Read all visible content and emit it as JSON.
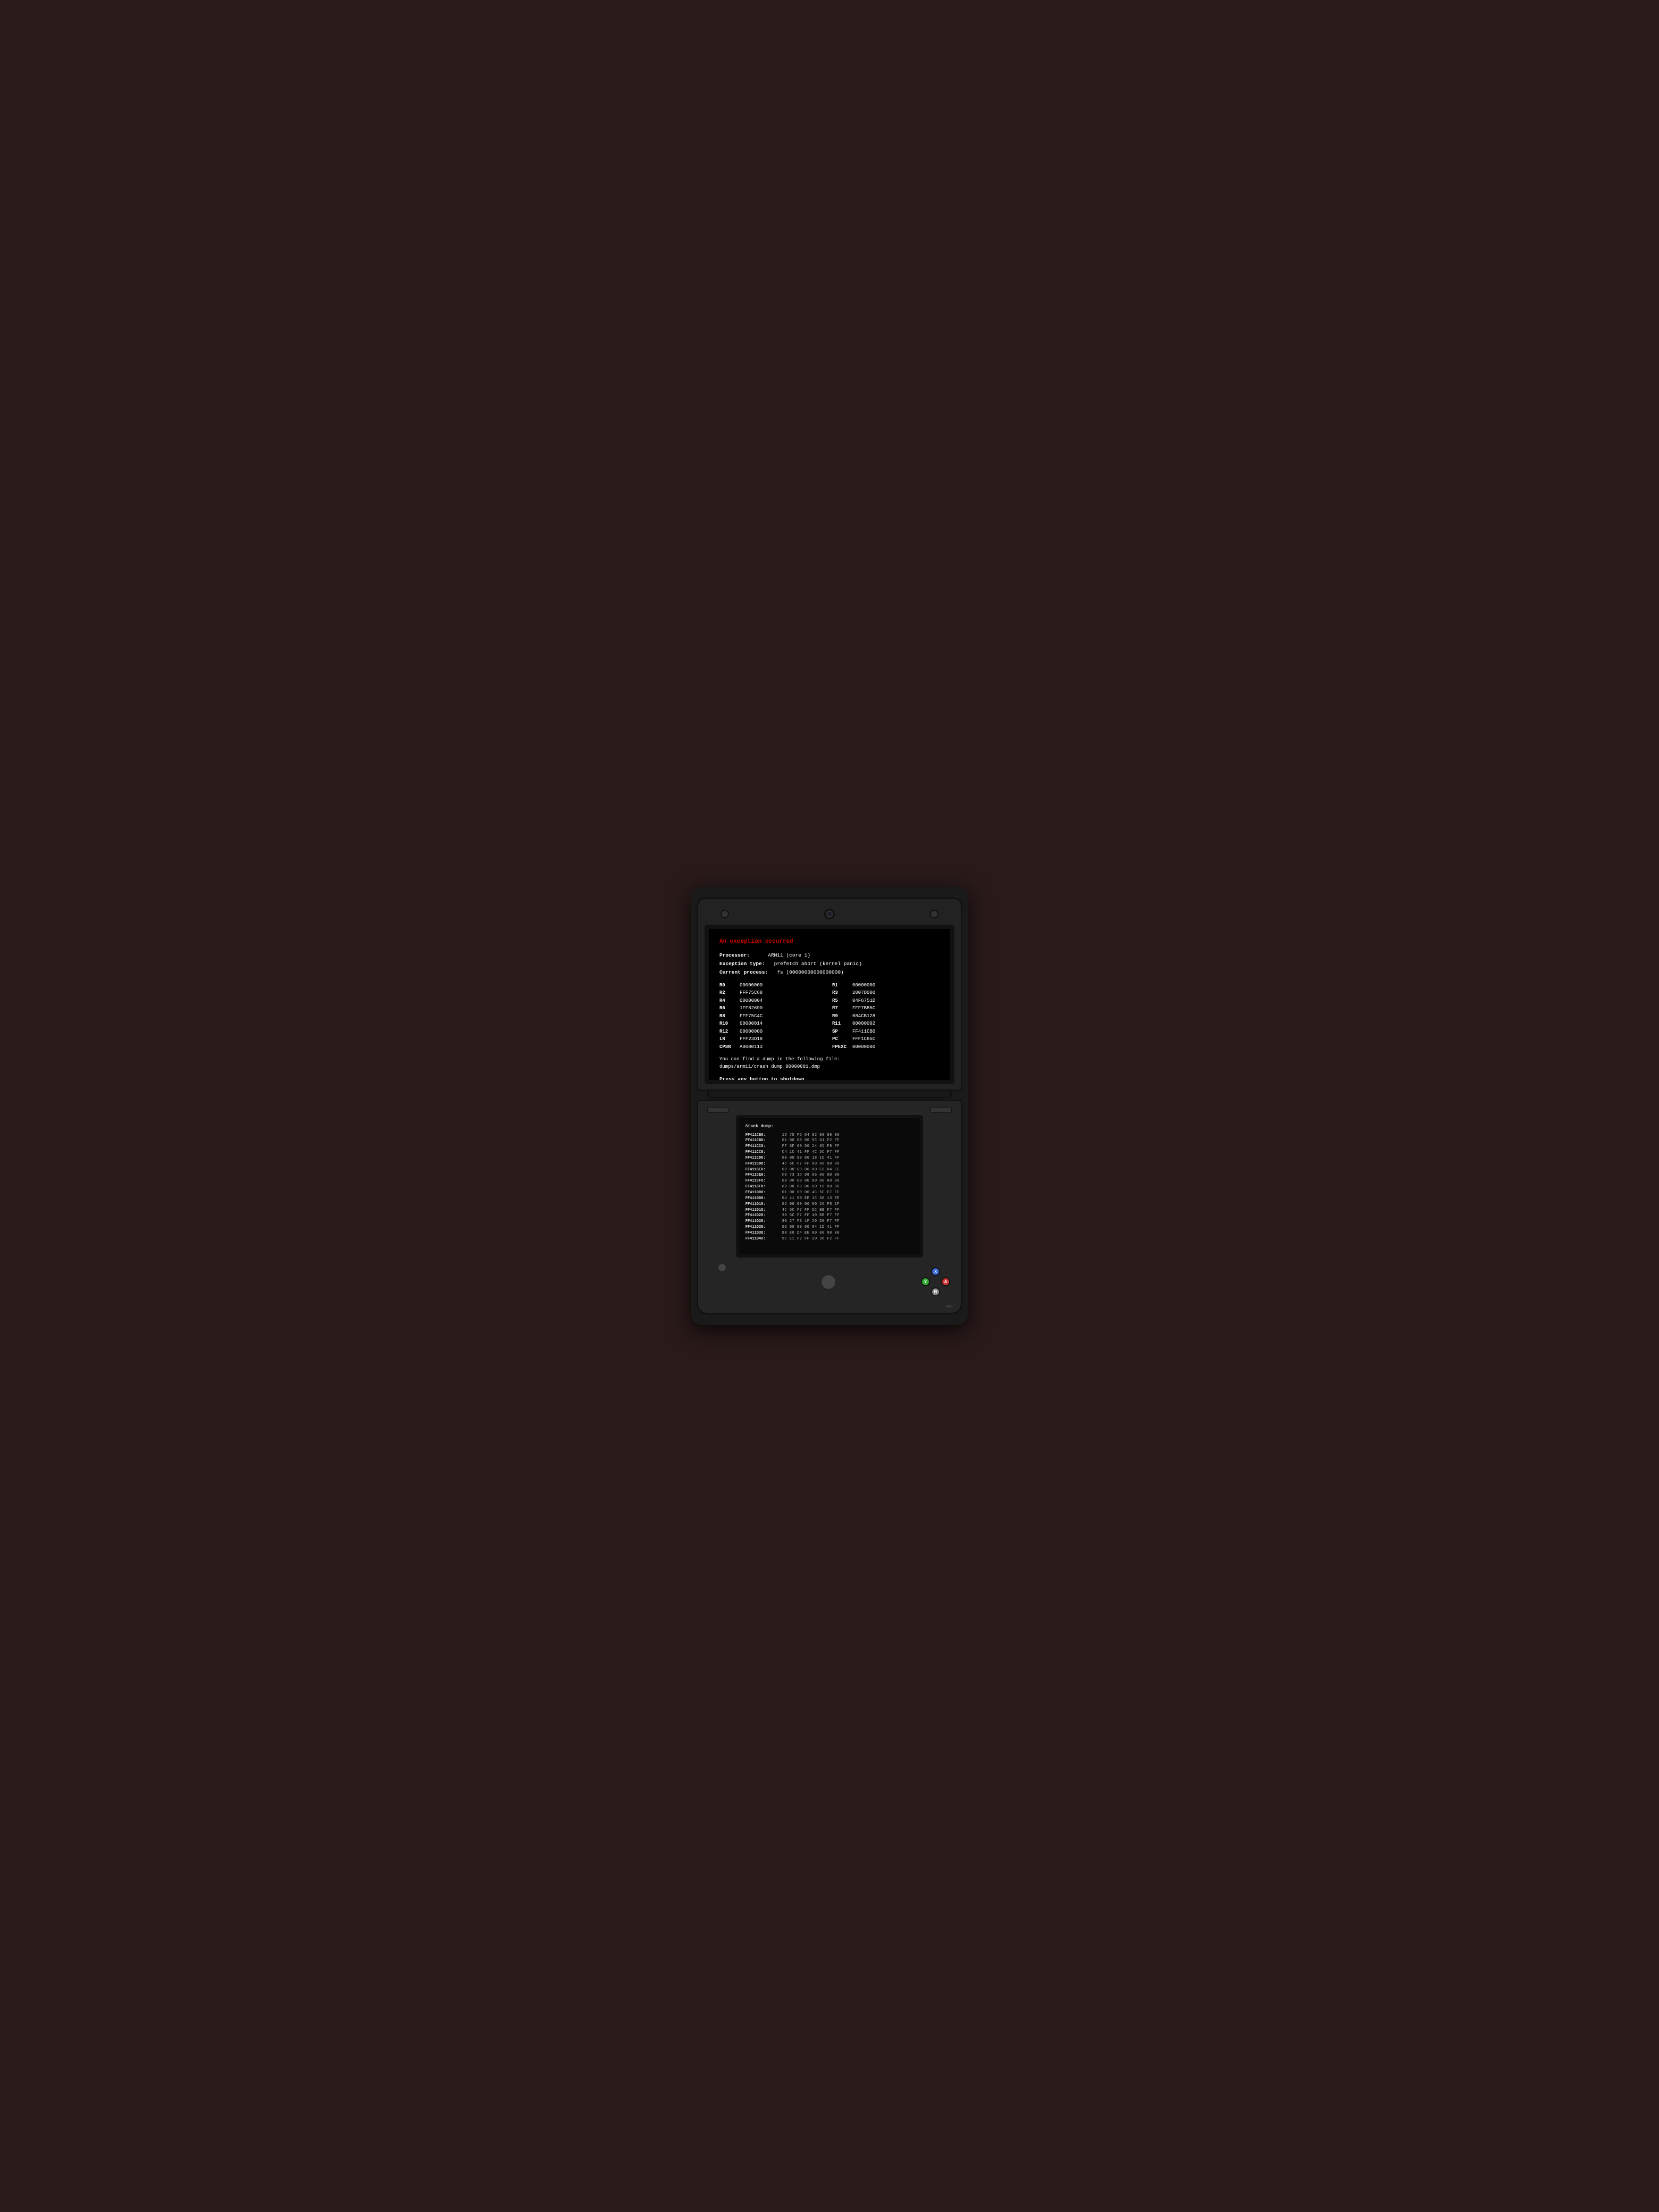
{
  "device": {
    "top_screen": {
      "error_title": "An exception occurred",
      "processor_label": "Processor:",
      "processor_value": "ARM11 (core 1)",
      "exception_type_label": "Exception type:",
      "exception_type_value": "prefetch abort (kernel panic)",
      "current_process_label": "Current process:",
      "current_process_value": "fs (00000000000000000)",
      "registers": [
        {
          "name": "R0",
          "value": "00000000"
        },
        {
          "name": "R1",
          "value": "00000000"
        },
        {
          "name": "R2",
          "value": "FFF75C68"
        },
        {
          "name": "R3",
          "value": "2007D000"
        },
        {
          "name": "R4",
          "value": "00000004"
        },
        {
          "name": "R5",
          "value": "04F6751D"
        },
        {
          "name": "R6",
          "value": "1FF82690"
        },
        {
          "name": "R7",
          "value": "FFF7BB5C"
        },
        {
          "name": "R8",
          "value": "FFF75C4C"
        },
        {
          "name": "R9",
          "value": "084CB128"
        },
        {
          "name": "R10",
          "value": "00000014"
        },
        {
          "name": "R11",
          "value": "00000002"
        },
        {
          "name": "R12",
          "value": "00000000"
        },
        {
          "name": "SP",
          "value": "FF411CB0"
        },
        {
          "name": "LR",
          "value": "FFF23D18"
        },
        {
          "name": "PC",
          "value": "FFF1C85C"
        },
        {
          "name": "CPSR",
          "value": "A0000113"
        },
        {
          "name": "FPEXC",
          "value": "00000000"
        }
      ],
      "dump_message": "You can find a dump in the following file:",
      "dump_path": "dumps/arm11/crash_dump_00000001.dmp",
      "press_message": "Press any button to shutdown"
    },
    "bottom_screen": {
      "title": "Stack dump:",
      "rows": [
        {
          "addr": "FF411CB0:",
          "vals": "1D 75 F6 04  02 00 00 00"
        },
        {
          "addr": "FF411CB8:",
          "vals": "01 00 00 00  9C 01 F2 FF"
        },
        {
          "addr": "FF411CC0:",
          "vals": "FF 6F 00 00  24 85 F9 FF"
        },
        {
          "addr": "FF411CC8:",
          "vals": "C4 1C 41 FF  4C 5C F7 FF"
        },
        {
          "addr": "FF411CD0:",
          "vals": "00 00 00 00  18 1D 41 FF"
        },
        {
          "addr": "FF411CD8:",
          "vals": "4C 5C F7 FF  00 00 00 00"
        },
        {
          "addr": "FF411CE0:",
          "vals": "00 00 00 00  80 E0 D4 EE"
        },
        {
          "addr": "FF411CE8:",
          "vals": "C0 73 1D 08  06 00 00 00"
        },
        {
          "addr": "FF411CF0:",
          "vals": "00 00 00 00  00 00 00 00"
        },
        {
          "addr": "FF411CF8:",
          "vals": "00 00 00 00  00 10 00 00"
        },
        {
          "addr": "FF411D00:",
          "vals": "01 00 00 00  4C 5C F7 FF"
        },
        {
          "addr": "FF411D08:",
          "vals": "04 41 0B EE  1C 60 13 EE"
        },
        {
          "addr": "FF411D10:",
          "vals": "02 00 00 00  80 26 F8 1F"
        },
        {
          "addr": "FF411D18:",
          "vals": "4C 5C F7 FF  5C BB F7 FF"
        },
        {
          "addr": "FF411D20:",
          "vals": "30 5C F7 FF  40 BB F7 FF"
        },
        {
          "addr": "FF411D28:",
          "vals": "80 27 F8 1F  20 D0 F7 FF"
        },
        {
          "addr": "FF411D30:",
          "vals": "03 00 00 00  84 1D 41 FF"
        },
        {
          "addr": "FF411D38:",
          "vals": "80 E0 D4 EE  00 00 00 00"
        },
        {
          "addr": "FF411D40:",
          "vals": "5C E1 F2 FF  20 36 F2 FF"
        }
      ]
    },
    "buttons": {
      "a_label": "A",
      "b_label": "B",
      "x_label": "X",
      "y_label": "Y",
      "mic_label": "MIC"
    }
  }
}
